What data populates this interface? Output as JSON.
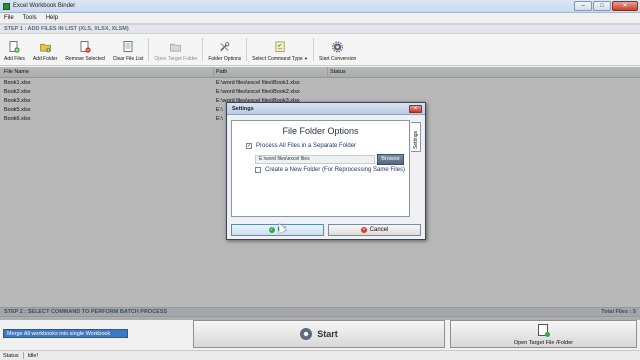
{
  "window": {
    "title": "Excel Workbook Binder",
    "controls": {
      "minimize": "–",
      "maximize": "□",
      "close": "✕"
    }
  },
  "menu": [
    "File",
    "Tools",
    "Help"
  ],
  "step1": "STEP 1 : ADD FILES IN LIST (XLS, XLSX, XLSM)",
  "toolbar": {
    "add_files": "Add Files",
    "add_folder": "Add Folder",
    "remove_selected": "Remove Selected",
    "clear_file_list": "Clear File List",
    "open_target_folder": "Open Target Folder",
    "folder_options": "Folder Options",
    "select_command_type": "Select Command Type",
    "start_conversion": "Start Conversion"
  },
  "columns": {
    "file_name": "File Name",
    "path": "Path",
    "status": "Status"
  },
  "files": [
    {
      "name": "Book1.xlsx",
      "path": "E:\\word files\\excel files\\Book1.xlsx"
    },
    {
      "name": "Book2.xlsx",
      "path": "E:\\word files\\excel files\\Book2.xlsx"
    },
    {
      "name": "Book3.xlsx",
      "path": "E:\\word files\\excel files\\Book3.xlsx"
    },
    {
      "name": "Book5.xlsx",
      "path": "E:\\"
    },
    {
      "name": "Book6.xlsx",
      "path": "E:\\"
    }
  ],
  "dialog": {
    "title": "Settings",
    "tab": "Settings",
    "heading": "File Folder Options",
    "process_separate": "Process All Files in a Separate Folder",
    "process_separate_checked": true,
    "folder_path": "E:\\word files\\excel files",
    "browse": "Browse",
    "create_new_folder": "Create a New Folder (For Reprocessing Same Files)",
    "create_new_folder_checked": false,
    "ok": "OK",
    "cancel": "Cancel"
  },
  "step2": "STEP 2 : SELECT COMMAND TO PERFORM BATCH PROCESS",
  "total_files": "Total Files : 5",
  "command_selected": "Merge All workbooks into single Workbook",
  "start": "Start",
  "open_target": "Open Target File /Folder",
  "status": {
    "label": "Status",
    "value": "Idle!"
  },
  "colors": {
    "selection": "#3b79c3",
    "title_bar": "#c9d9ee",
    "close_button": "#c7402a"
  }
}
